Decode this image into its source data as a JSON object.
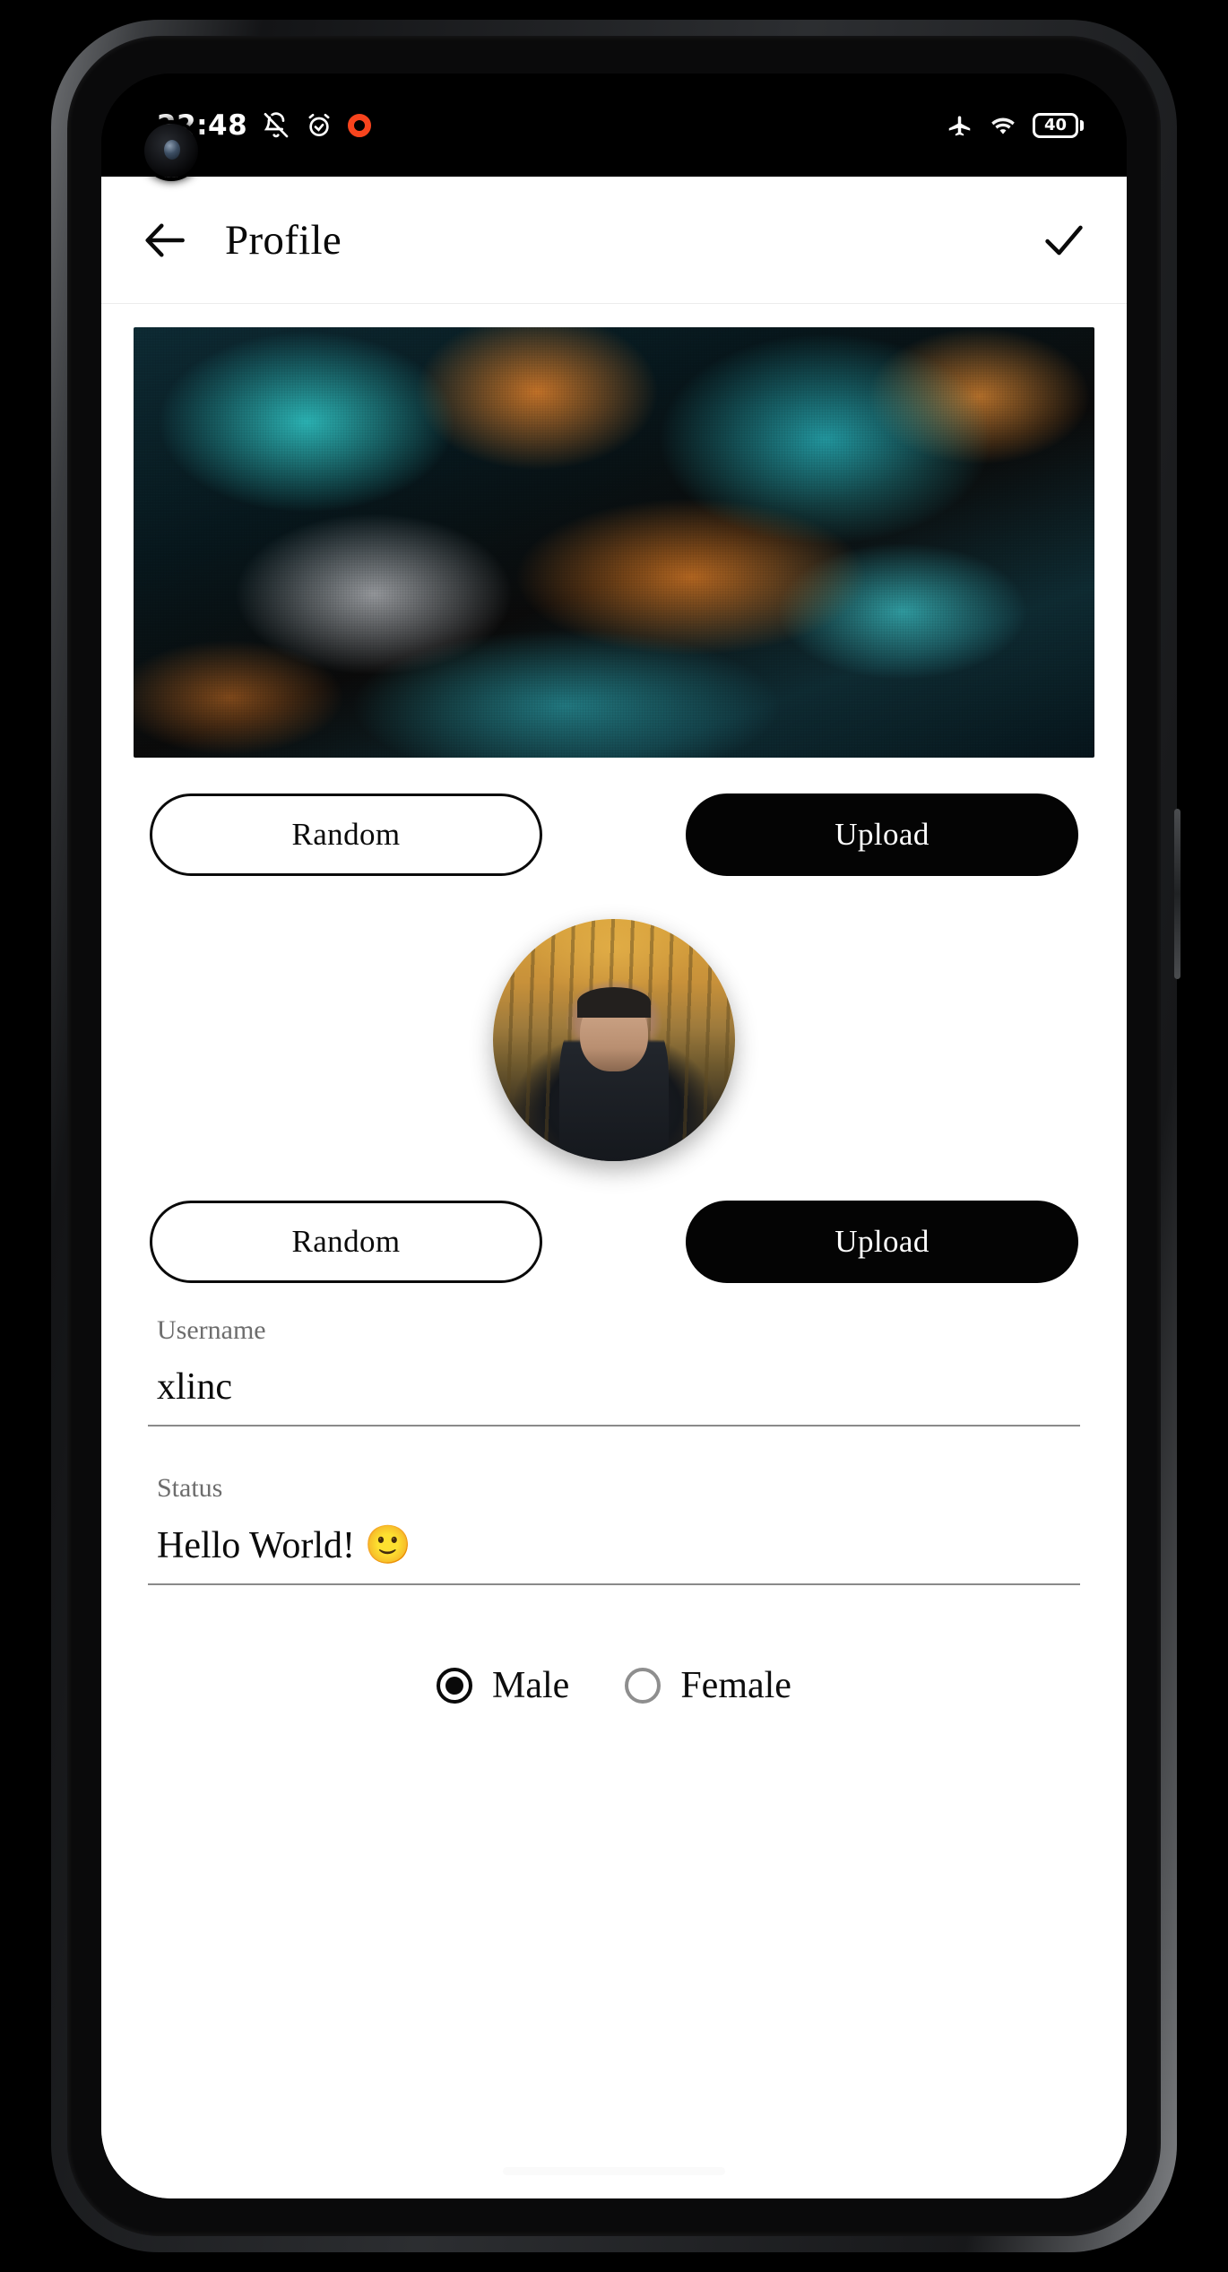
{
  "status_bar": {
    "time": "22:48",
    "icons_left": [
      "bell-off-icon",
      "alarm-clock-icon",
      "recording-indicator-icon"
    ],
    "icons_right": [
      "airplane-mode-icon",
      "wifi-icon",
      "battery-icon"
    ],
    "battery_level": "40"
  },
  "appbar": {
    "back_icon": "back-arrow-icon",
    "title": "Profile",
    "confirm_icon": "checkmark-icon"
  },
  "banner": {
    "alt": "abstract teal and orange textured banner image"
  },
  "banner_actions": {
    "random_label": "Random",
    "upload_label": "Upload"
  },
  "avatar": {
    "alt": "profile photo of a person in an autumn forest"
  },
  "avatar_actions": {
    "random_label": "Random",
    "upload_label": "Upload"
  },
  "form": {
    "username": {
      "label": "Username",
      "value": "xlinc"
    },
    "status": {
      "label": "Status",
      "value": "Hello World! 🙂"
    }
  },
  "gender": {
    "options": [
      {
        "label": "Male",
        "selected": true
      },
      {
        "label": "Female",
        "selected": false
      }
    ]
  },
  "colors": {
    "accent": "#040404",
    "label_gray": "#6d6d6d",
    "underline_gray": "#8a8a8a",
    "recording_orange": "#f8441d",
    "background": "#ffffff"
  }
}
